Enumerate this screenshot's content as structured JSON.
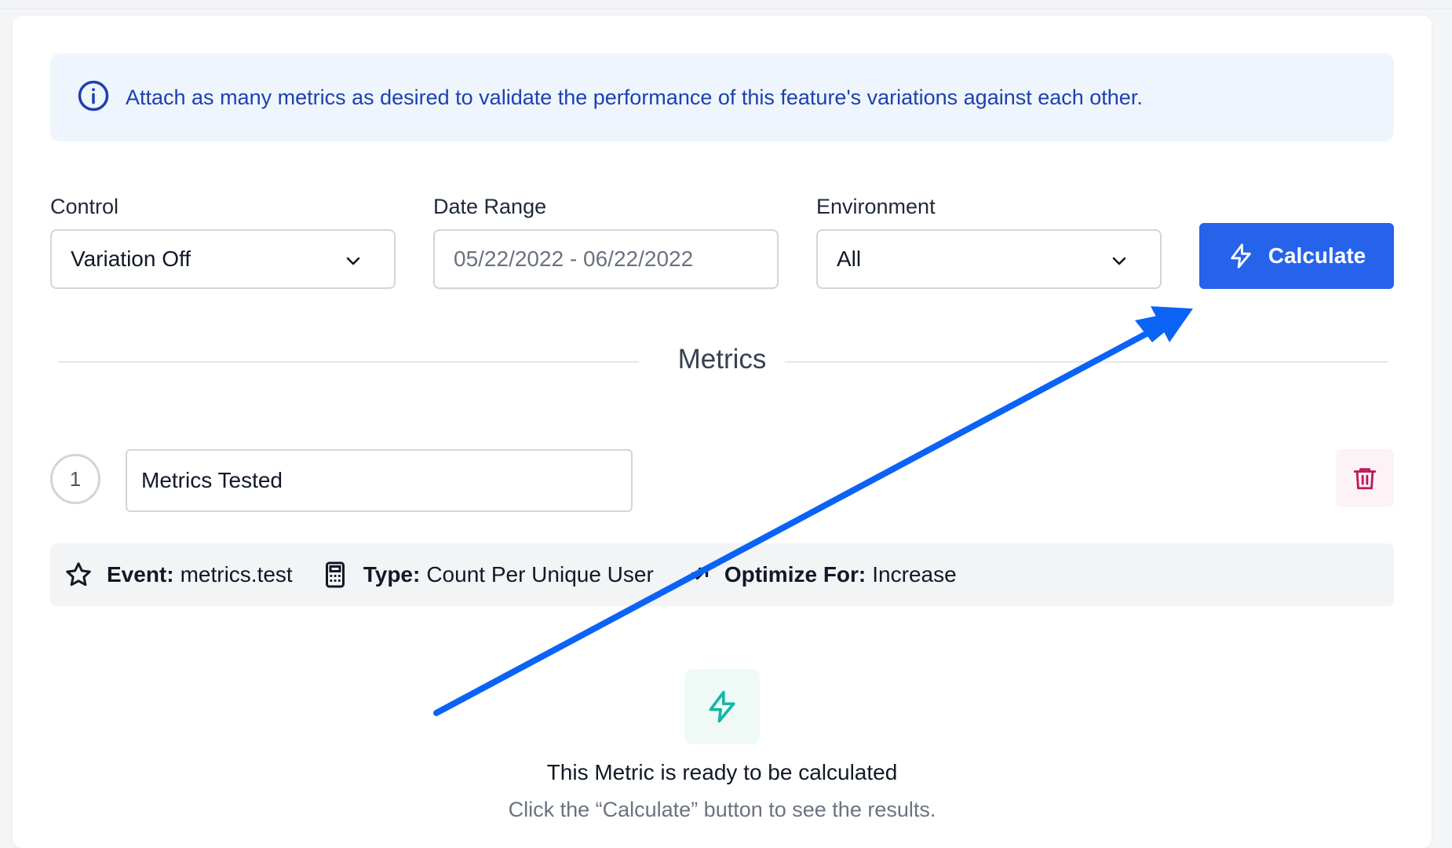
{
  "info_banner": {
    "text": "Attach as many metrics as desired to validate the performance of this feature's variations against each other."
  },
  "filters": {
    "control_label": "Control",
    "control_value": "Variation Off",
    "date_range_label": "Date Range",
    "date_range_value": "05/22/2022 - 06/22/2022",
    "environment_label": "Environment",
    "environment_value": "All",
    "calculate_label": "Calculate"
  },
  "metrics_heading": "Metrics",
  "metric": {
    "index": "1",
    "name": "Metrics Tested",
    "event_key": "Event:",
    "event_value": "metrics.test",
    "type_key": "Type:",
    "type_value": "Count Per Unique User",
    "optimize_key": "Optimize For:",
    "optimize_value": "Increase"
  },
  "empty_state": {
    "title": "This Metric is ready to be calculated",
    "subtitle": "Click the “Calculate” button to see the results."
  },
  "colors": {
    "accent": "#2563eb",
    "info_bg": "#eef5fd",
    "info_text": "#1e40af",
    "danger": "#be185d",
    "success": "#14b8a6",
    "annotation_arrow": "#0b63f6"
  }
}
